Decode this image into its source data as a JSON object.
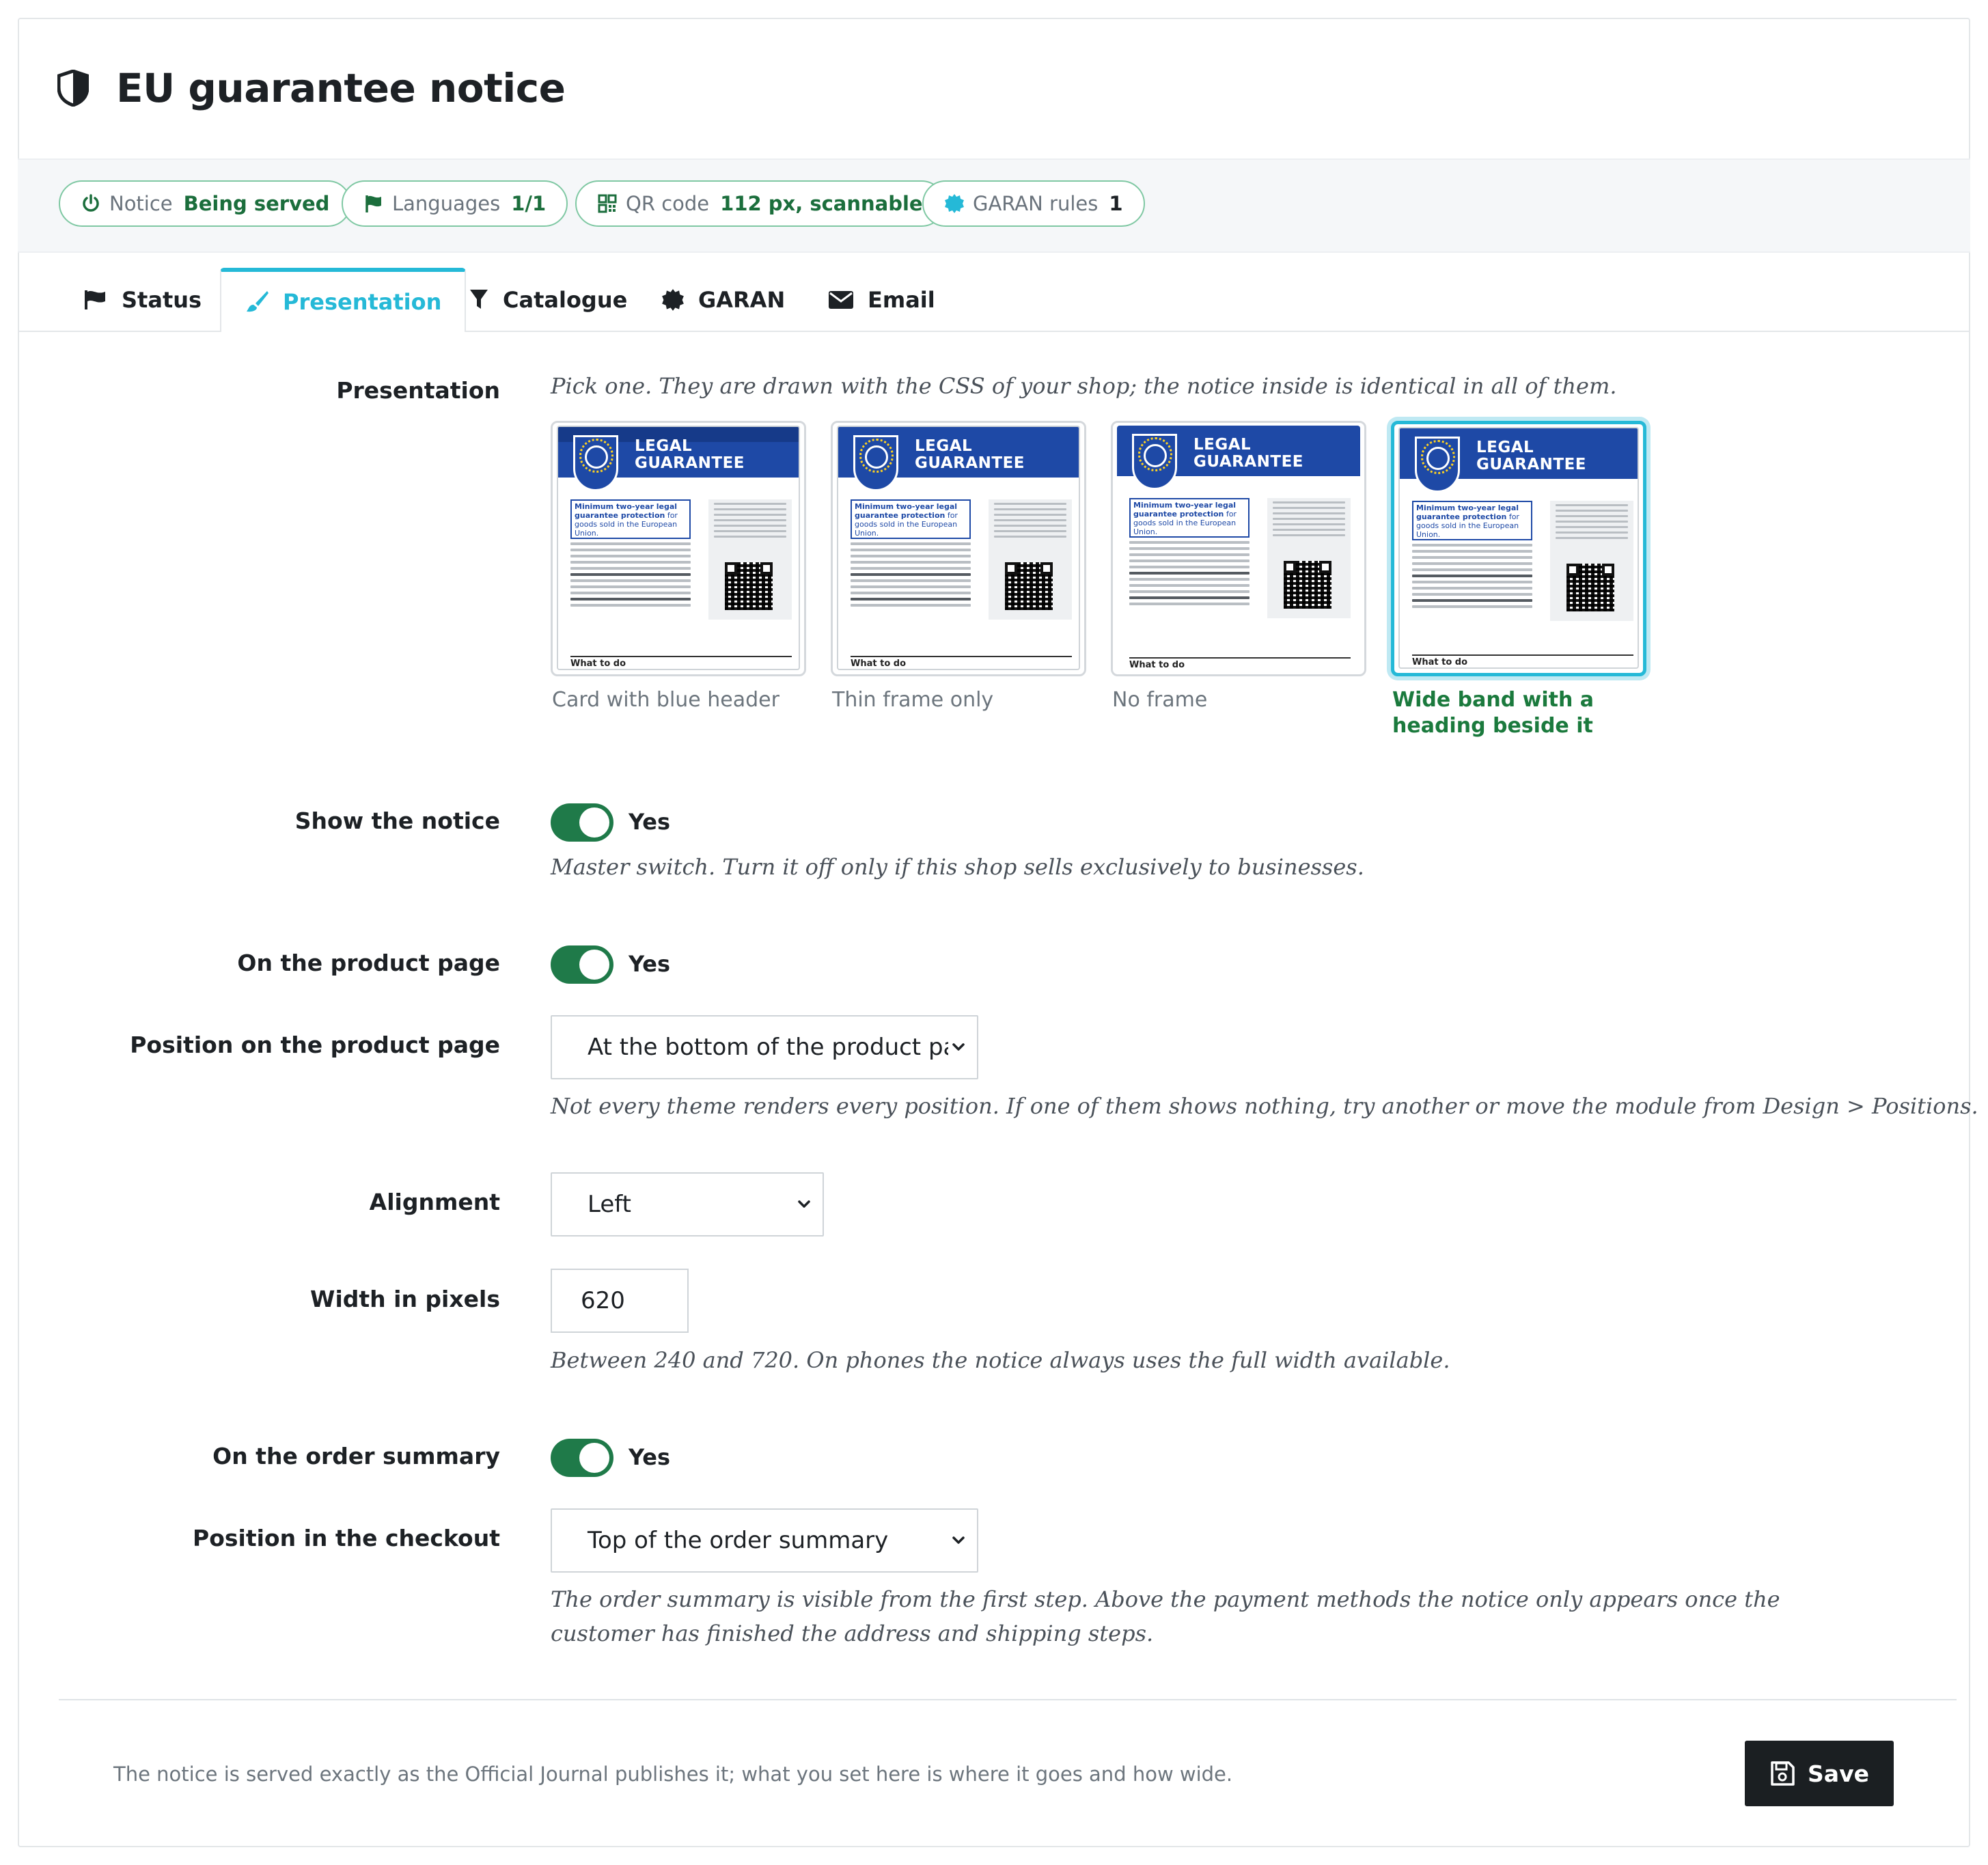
{
  "page": {
    "title": "EU guarantee notice",
    "title_icon": "shield-half-icon"
  },
  "status_chips": [
    {
      "icon": "power-icon",
      "key": "Notice",
      "value": "Being served"
    },
    {
      "icon": "flag-icon",
      "key": "Languages",
      "value": "1/1"
    },
    {
      "icon": "qr-code-icon",
      "key": "QR code",
      "value": "112 px, scannable"
    },
    {
      "icon": "seal-badge-icon",
      "key": "GARAN rules",
      "value": "1"
    }
  ],
  "tabs": [
    {
      "icon": "flag-icon",
      "label": "Status"
    },
    {
      "icon": "paintbrush-icon",
      "label": "Presentation",
      "active": true
    },
    {
      "icon": "filter-icon",
      "label": "Catalogue"
    },
    {
      "icon": "seal-badge-icon",
      "label": "GARAN"
    },
    {
      "icon": "envelope-icon",
      "label": "Email"
    }
  ],
  "presentation": {
    "label": "Presentation",
    "help": "Pick one. They are drawn with the CSS of your shop; the notice inside is identical in all of them.",
    "preview": {
      "heading_line1": "LEGAL",
      "heading_line2": "GUARANTEE",
      "box_bold": "Minimum two-year legal guarantee protection",
      "box_rest": "for goods sold in the European Union.",
      "footer": "What to do"
    },
    "options": [
      {
        "caption": "Card with blue header",
        "selected": false
      },
      {
        "caption": "Thin frame only",
        "selected": false
      },
      {
        "caption": "No frame",
        "selected": false
      },
      {
        "caption": "Wide band with a heading beside it",
        "selected": true
      }
    ]
  },
  "show_notice": {
    "label": "Show the notice",
    "value": "Yes",
    "help": "Master switch. Turn it off only if this shop sells exclusively to businesses."
  },
  "product_page": {
    "label": "On the product page",
    "value": "Yes"
  },
  "product_position": {
    "label": "Position on the product page",
    "selected": "At the bottom of the product pa",
    "help": "Not every theme renders every position. If one of them shows nothing, try another or move the module from Design > Positions."
  },
  "alignment": {
    "label": "Alignment",
    "selected": "Left"
  },
  "width": {
    "label": "Width in pixels",
    "value": "620",
    "help": "Between 240 and 720. On phones the notice always uses the full width available."
  },
  "order_summary": {
    "label": "On the order summary",
    "value": "Yes"
  },
  "checkout_position": {
    "label": "Position in the checkout",
    "selected": "Top of the order summary",
    "help": "The order summary is visible from the first step. Above the payment methods the notice only appears once the customer has finished the address and shipping steps."
  },
  "footer": {
    "note": "The notice is served exactly as the Official Journal publishes it; what you set here is where it goes and how wide.",
    "save_label": "Save"
  },
  "colors": {
    "accent": "#25b9d7",
    "success": "#1f7a49",
    "eu_blue": "#1e49a6"
  }
}
